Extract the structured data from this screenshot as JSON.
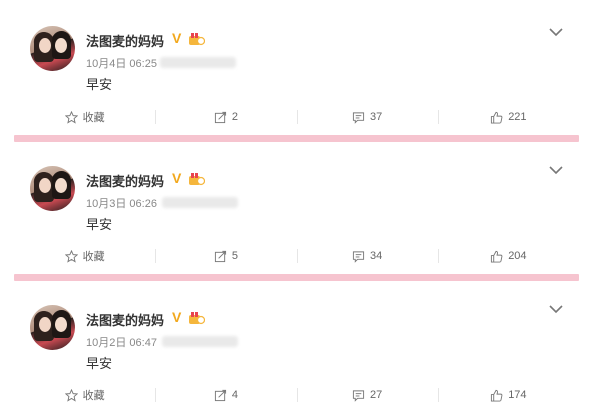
{
  "posts": [
    {
      "username": "法图麦的妈妈",
      "verified_mark": "V",
      "time": "10月4日 06:25",
      "content": "早安",
      "actions": {
        "favorite": "收藏",
        "repost": "2",
        "comment": "37",
        "like": "221"
      }
    },
    {
      "username": "法图麦的妈妈",
      "verified_mark": "V",
      "time": "10月3日 06:26",
      "content": "早安",
      "actions": {
        "favorite": "收藏",
        "repost": "5",
        "comment": "34",
        "like": "204"
      }
    },
    {
      "username": "法图麦的妈妈",
      "verified_mark": "V",
      "time": "10月2日 06:47",
      "content": "早安",
      "actions": {
        "favorite": "收藏",
        "repost": "4",
        "comment": "27",
        "like": "174"
      }
    }
  ],
  "icons": {
    "favorite": "star-icon",
    "repost": "repost-icon",
    "comment": "comment-icon",
    "like": "thumbs-up-icon",
    "menu": "chevron-down-icon",
    "badge": "medal-icon"
  },
  "colors": {
    "divider": "#f6c4cf",
    "verified": "#f2a81d",
    "meta_text": "#888888"
  }
}
